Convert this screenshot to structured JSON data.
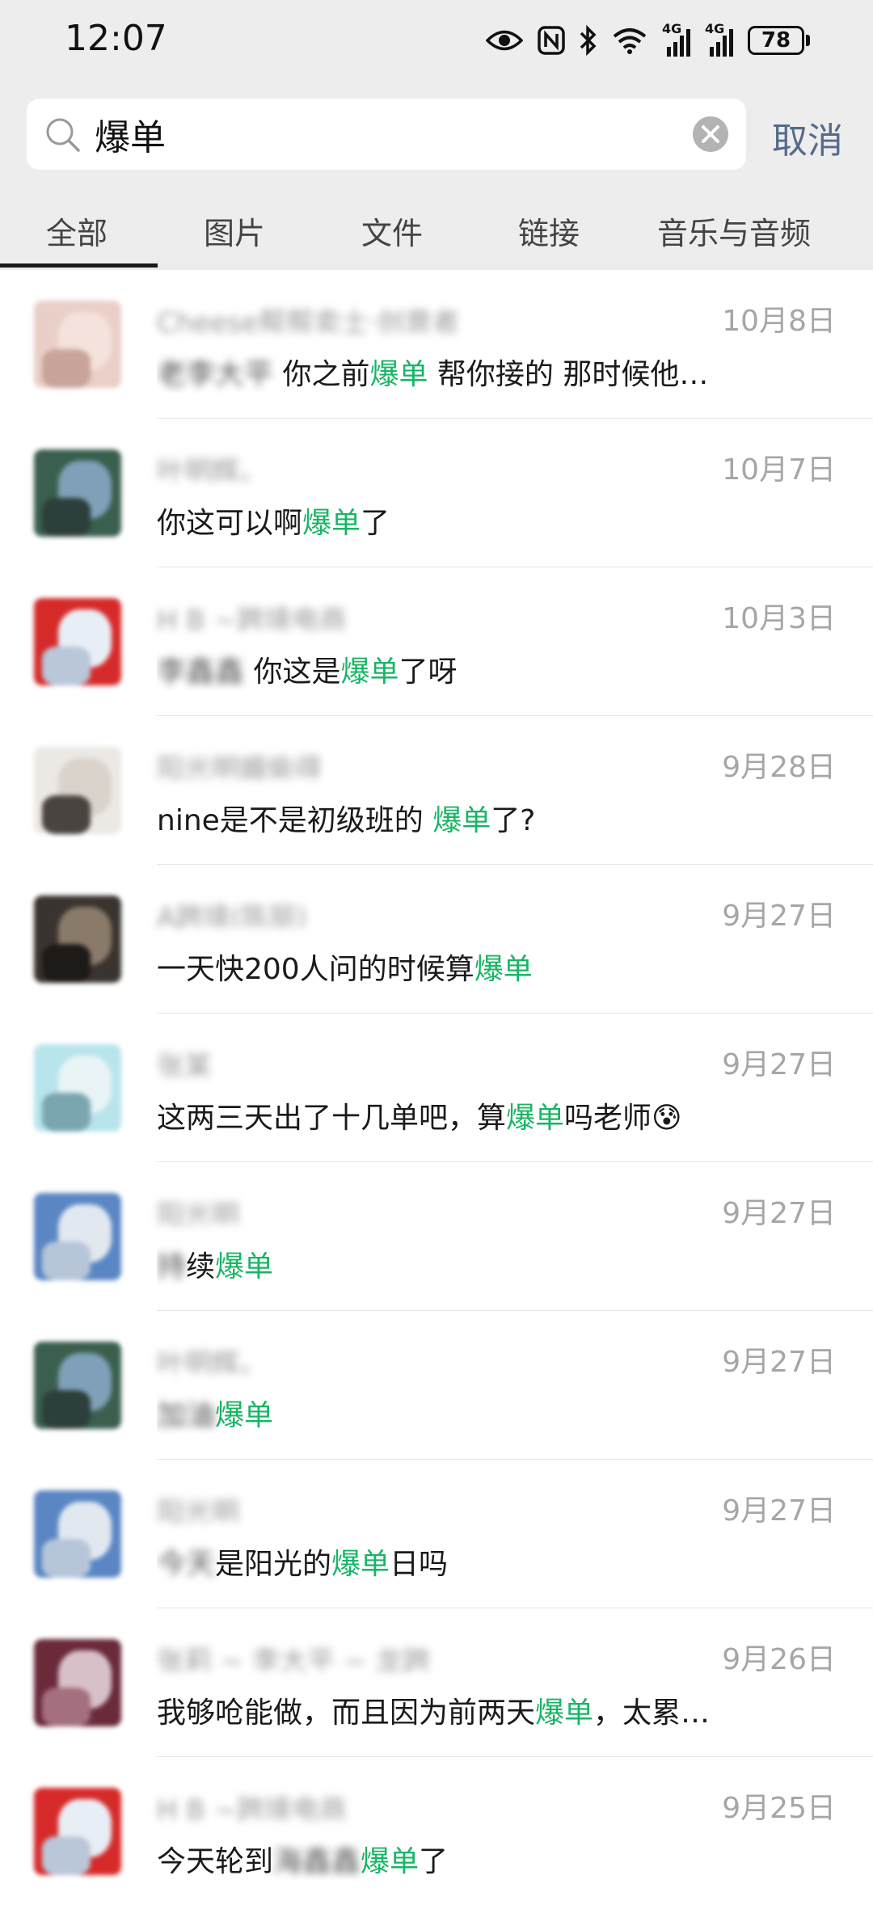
{
  "status": {
    "time": "12:07",
    "network_a": "4G",
    "network_b": "4G",
    "battery": "78"
  },
  "search": {
    "query": "爆单",
    "cancel_label": "取消"
  },
  "tabs": [
    {
      "label": "全部",
      "selected": true
    },
    {
      "label": "图片",
      "selected": false
    },
    {
      "label": "文件",
      "selected": false
    },
    {
      "label": "链接",
      "selected": false
    },
    {
      "label": "音乐与音频",
      "selected": false
    }
  ],
  "colors": {
    "highlight": "#18b566",
    "cancel": "#566a8c"
  },
  "results": [
    {
      "name": "Cheese帮帮卖士·创意者",
      "date": "10月8日",
      "pre_blur": "老李大平",
      "before": " 你之前",
      "keyword": "爆单",
      "after": " 帮你接的 那时候他…"
    },
    {
      "name": "叶明辉。",
      "date": "10月7日",
      "pre_blur": "",
      "before": "你这可以啊",
      "keyword": "爆单",
      "after": "了"
    },
    {
      "name": "H B ~跨境电商",
      "date": "10月3日",
      "pre_blur": "李鑫鑫",
      "before": " 你这是",
      "keyword": "爆单",
      "after": "了呀"
    },
    {
      "name": "阳光明媚偷得",
      "date": "9月28日",
      "pre_blur": "",
      "before": "nine是不是初级班的 ",
      "keyword": "爆单",
      "after": "了?"
    },
    {
      "name": "A跨境(陈丽)",
      "date": "9月27日",
      "pre_blur": "",
      "before": "一天快200人问的时候算",
      "keyword": "爆单",
      "after": ""
    },
    {
      "name": "张某",
      "date": "9月27日",
      "pre_blur": "",
      "before": "这两三天出了十几单吧，算",
      "keyword": "爆单",
      "after": "吗老师😰"
    },
    {
      "name": "阳光明",
      "date": "9月27日",
      "pre_blur": "持",
      "before": "续",
      "keyword": "爆单",
      "after": ""
    },
    {
      "name": "叶明辉。",
      "date": "9月27日",
      "pre_blur": "加油",
      "before": "",
      "keyword": "爆单",
      "after": ""
    },
    {
      "name": "阳光明",
      "date": "9月27日",
      "pre_blur": "今天",
      "before": "是阳光的",
      "keyword": "爆单",
      "after": "日吗"
    },
    {
      "name": "张莉 ~ 李大平 ~ 龙跨",
      "date": "9月26日",
      "pre_blur": "",
      "before": "我够呛能做，而且因为前两天",
      "keyword": "爆单",
      "after": "，太累…"
    },
    {
      "name": "H B ~跨境电商",
      "date": "9月25日",
      "pre_blur": "",
      "before": "今天轮到",
      "keyword": "爆单",
      "after": "了",
      "mid_blur": "海鑫鑫"
    }
  ]
}
